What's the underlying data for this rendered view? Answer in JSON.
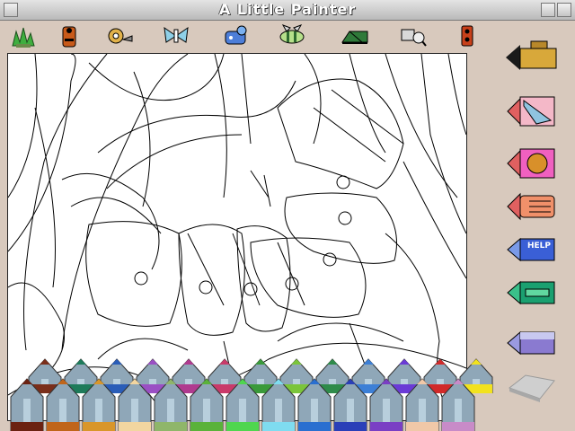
{
  "app": {
    "title": "A  Little  Painter"
  },
  "toolbar": {
    "tools": [
      {
        "name": "grass-stamp"
      },
      {
        "name": "ladybug-stamp"
      },
      {
        "name": "snail-stamp"
      },
      {
        "name": "butterfly-stamp"
      },
      {
        "name": "fish-stamp"
      },
      {
        "name": "bee-stamp"
      },
      {
        "name": "pencil-stamp"
      },
      {
        "name": "magnifier-stamp"
      },
      {
        "name": "beetle-stamp"
      }
    ]
  },
  "side": {
    "help_label": "HELP",
    "buttons": [
      {
        "name": "trumpet-icon"
      },
      {
        "name": "paper-icon"
      },
      {
        "name": "cookie-icon"
      },
      {
        "name": "hand-icon"
      },
      {
        "name": "help-icon"
      },
      {
        "name": "card-icon"
      },
      {
        "name": "eraser-tip-icon"
      },
      {
        "name": "eraser-icon"
      }
    ]
  },
  "palette": {
    "top_row": [
      "#7a2e1a",
      "#1e7b5a",
      "#2a5db8",
      "#9a4fc4",
      "#b03a8f",
      "#c93a6a",
      "#3a9a3a",
      "#7bc53b",
      "#2e8b4a",
      "#3c7fd6",
      "#6a3ad6",
      "#d12a2a",
      "#f2e21e"
    ],
    "bottom_row": [
      "#6b2212",
      "#c0651a",
      "#d9962a",
      "#f2d6a0",
      "#8fb66a",
      "#5ab23a",
      "#4fd64f",
      "#7fdcf0",
      "#2a6fd0",
      "#2a3fb8",
      "#7a3fc4",
      "#f0c8a8",
      "#c88bc8"
    ]
  },
  "colors": {
    "canvas_bg": "#ffffff",
    "frame": "#d8c9bd",
    "pencil_wood": "#8fa7b8"
  }
}
